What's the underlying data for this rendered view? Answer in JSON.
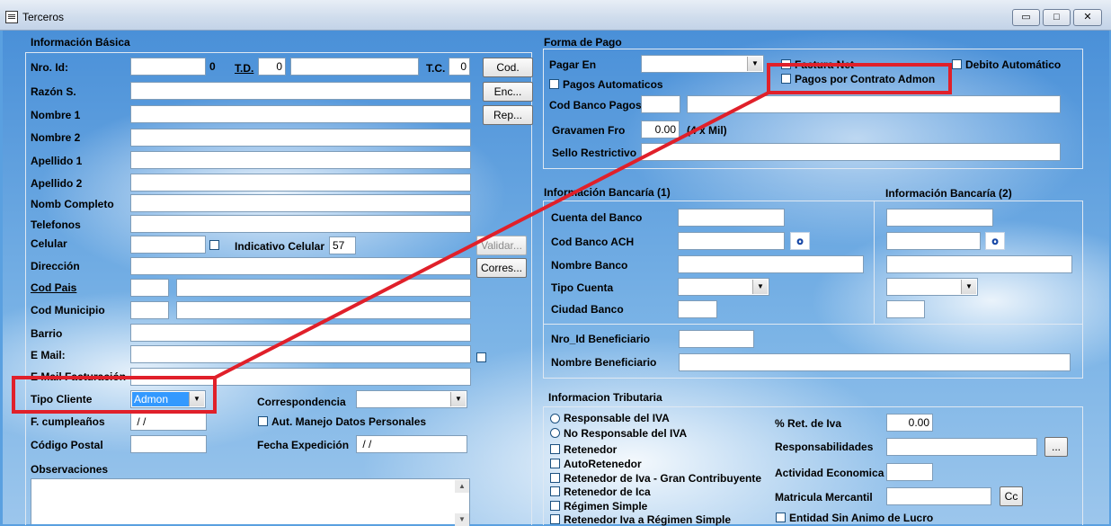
{
  "window": {
    "title": "Terceros",
    "min": "▭",
    "max": "□",
    "close": "✕"
  },
  "basic": {
    "title": "Información Básica",
    "nro_id": {
      "label": "Nro. Id:",
      "value": "",
      "suffix": "0"
    },
    "td": {
      "label": "T.D.",
      "value": "0"
    },
    "tc": {
      "label": "T.C.",
      "value": "0"
    },
    "razon": {
      "label": "Razón S.",
      "value": ""
    },
    "nombre1": {
      "label": "Nombre 1",
      "value": ""
    },
    "nombre2": {
      "label": "Nombre 2",
      "value": ""
    },
    "apellido1": {
      "label": "Apellido 1",
      "value": ""
    },
    "apellido2": {
      "label": "Apellido 2",
      "value": ""
    },
    "nomb_completo": {
      "label": "Nomb Completo",
      "value": ""
    },
    "telefonos": {
      "label": "Telefonos",
      "value": ""
    },
    "celular": {
      "label": "Celular",
      "value": ""
    },
    "indicativo": {
      "label": "Indicativo Celular",
      "value": "57"
    },
    "direccion": {
      "label": "Dirección",
      "value": ""
    },
    "cod_pais": {
      "label": "Cod Pais",
      "value": ""
    },
    "cod_municipio": {
      "label": "Cod Municipio",
      "value": ""
    },
    "barrio": {
      "label": "Barrio",
      "value": ""
    },
    "email": {
      "label": "E Mail:",
      "value": ""
    },
    "email_fact": {
      "label": "E Mail Facturación",
      "value": ""
    },
    "tipo_cliente": {
      "label": "Tipo Cliente",
      "value": "Admon"
    },
    "correspondencia": {
      "label": "Correspondencia",
      "value": ""
    },
    "f_cumple": {
      "label": "F. cumpleaños",
      "value": " / /"
    },
    "aut_manejo": {
      "label": "Aut. Manejo Datos Personales"
    },
    "codigo_postal": {
      "label": "Código Postal",
      "value": ""
    },
    "fecha_exp": {
      "label": "Fecha Expedición",
      "value": " / /"
    },
    "observaciones": {
      "label": "Observaciones",
      "value": ""
    }
  },
  "buttons": {
    "cod": "Cod.",
    "enc": "Enc...",
    "rep": "Rep...",
    "validar": "Validar...",
    "corres": "Corres..."
  },
  "pago": {
    "title": "Forma de Pago",
    "pagar_en": {
      "label": "Pagar En",
      "value": ""
    },
    "factura_net": "Factura Net",
    "debito_auto": "Debito Automático",
    "pagos_auto": "Pagos Automaticos",
    "pagos_contrato": "Pagos por Contrato Admon",
    "cod_banco_pagos": {
      "label": "Cod Banco Pagos",
      "value": "",
      "desc": ""
    },
    "gravamen": {
      "label": "Gravamen Fro",
      "value": "0.00",
      "unit": "(4 x Mil)"
    },
    "sello": {
      "label": "Sello Restrictivo",
      "value": ""
    }
  },
  "bancaria": {
    "title1": "Información Bancaría (1)",
    "title2": "Información Bancaría (2)",
    "cuenta": "Cuenta del Banco",
    "cod_ach": "Cod Banco ACH",
    "nombre_banco": "Nombre Banco",
    "tipo_cuenta": "Tipo Cuenta",
    "ciudad": "Ciudad Banco",
    "nro_benef": "Nro_Id Beneficiario",
    "nombre_benef": "Nombre Beneficiario"
  },
  "tributaria": {
    "title": "Informacion Tributaria",
    "responsable": "Responsable del IVA",
    "no_responsable": "No Responsable del IVA",
    "retenedor": "Retenedor",
    "autoretenedor": "AutoRetenedor",
    "ret_gran": "Retenedor de Iva - Gran Contribuyente",
    "ret_ica": "Retenedor de Ica",
    "regimen": "Régimen Simple",
    "ret_iva_regimen": "Retenedor Iva a Régimen Simple",
    "ret_iva": {
      "label": "% Ret. de Iva",
      "value": "0.00"
    },
    "responsabilidades": {
      "label": "Responsabilidades",
      "value": "",
      "btn": "..."
    },
    "actividad": {
      "label": "Actividad Economica",
      "value": ""
    },
    "matricula": {
      "label": "Matricula Mercantil",
      "value": "",
      "btn": "Cc"
    },
    "entidad": "Entidad Sin Animo de Lucro"
  },
  "annotation": {
    "color": "#e0202a"
  }
}
